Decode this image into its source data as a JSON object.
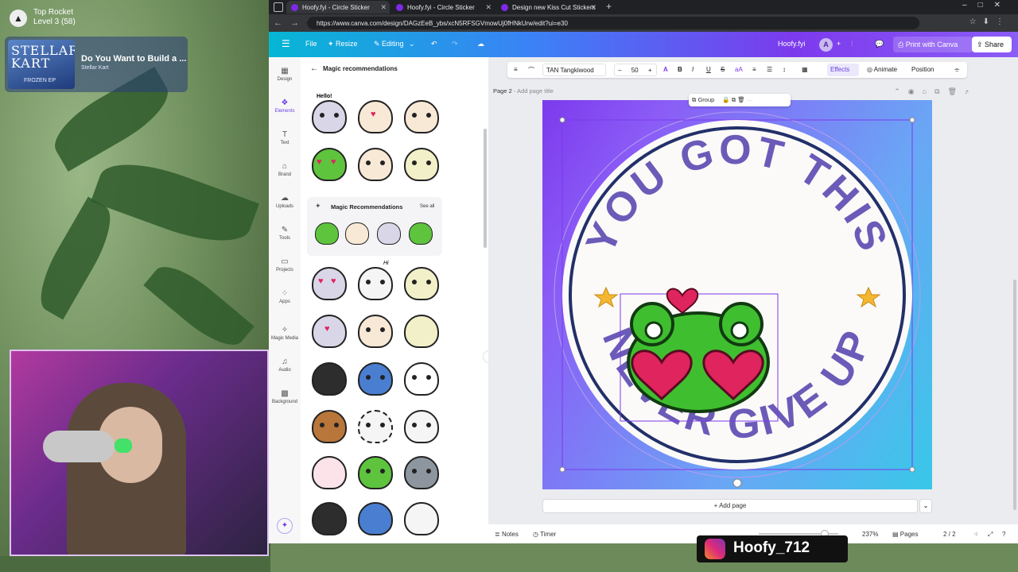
{
  "stream": {
    "notification": {
      "line1": "Top Rocket",
      "line2": "Level 3  (58)"
    },
    "music": {
      "cover_text": "STELLAR KART",
      "cover_sub": "FROZEN EP",
      "title": "Do You Want to Build a ...",
      "artist": "Stellar Kart"
    },
    "tag": "Hoofy_712"
  },
  "browser": {
    "tabs": [
      {
        "label": "Hoofy.fyi - Circle Sticker",
        "active": true
      },
      {
        "label": "Hoofy.fyi - Circle Sticker",
        "active": false
      },
      {
        "label": "Design new Kiss Cut Stickers",
        "active": false
      }
    ],
    "url": "https://www.canva.com/design/DAGzEeB_ybs/xcN5RFSGVmowUj0fHNkUrw/edit?ui=e30"
  },
  "canva_top": {
    "file": "File",
    "resize": "Resize",
    "mode": "Editing",
    "brand_name": "Hoofy.fyi",
    "avatar_letter": "A",
    "print": "Print with Canva",
    "share": "Share"
  },
  "rail": [
    {
      "label": "Design",
      "icon": "layout-icon"
    },
    {
      "label": "Elements",
      "icon": "elements-icon",
      "active": true
    },
    {
      "label": "Text",
      "icon": "text-icon"
    },
    {
      "label": "Brand",
      "icon": "brand-icon"
    },
    {
      "label": "Uploads",
      "icon": "upload-icon"
    },
    {
      "label": "Tools",
      "icon": "tools-icon"
    },
    {
      "label": "Projects",
      "icon": "folder-icon"
    },
    {
      "label": "Apps",
      "icon": "apps-icon"
    },
    {
      "label": "Magic Media",
      "icon": "magic-media-icon"
    },
    {
      "label": "Audio",
      "icon": "audio-icon"
    },
    {
      "label": "Background",
      "icon": "background-icon"
    }
  ],
  "panel": {
    "header": "Magic recommendations",
    "rec_box_title": "Magic Recommendations",
    "see_all": "See all",
    "stickers_top_label": "Hello!",
    "stickers_hi_label": "Hi"
  },
  "toolbar": {
    "font": "TAN Tangkiwood",
    "size": "50",
    "effects": "Effects",
    "animate": "Animate",
    "position": "Position"
  },
  "page": {
    "label": "Page 2",
    "title_placeholder": "Add page title",
    "group_label": "Group",
    "design_top_text": "YOU GOT THIS",
    "design_bottom_text": "NEVER GIVE UP",
    "add_page": "+ Add page"
  },
  "bottom": {
    "notes": "Notes",
    "timer": "Timer",
    "zoom": "237%",
    "pages_label": "Pages",
    "pages_value": "2 / 2"
  },
  "colors": {
    "canva_purple": "#7c3aed",
    "design_text": "#6b5bb8",
    "circle_border": "#22306a",
    "frog_green": "#3fbf2f",
    "heart_red": "#e0245e"
  }
}
